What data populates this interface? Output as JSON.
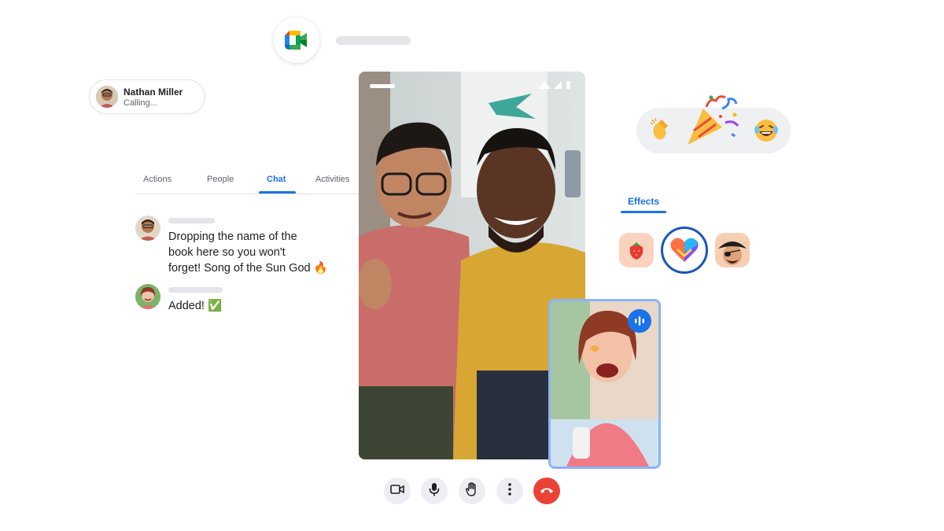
{
  "caller": {
    "name": "Nathan Miller",
    "status": "Calling..."
  },
  "tabs": [
    {
      "label": "Actions"
    },
    {
      "label": "People"
    },
    {
      "label": "Chat"
    },
    {
      "label": "Activities"
    }
  ],
  "active_tab": "Chat",
  "chat": {
    "messages": [
      {
        "text_lines": [
          "Dropping the name of the",
          "book here so you won't",
          "forget! Song of the Sun God 🔥"
        ]
      },
      {
        "text_lines": [
          "Added! ✅"
        ]
      }
    ]
  },
  "effects": {
    "label": "Effects"
  },
  "icons": {
    "meet": "google-meet-icon",
    "camera": "video-camera-icon",
    "mic": "microphone-icon",
    "hand": "raise-hand-icon",
    "more": "more-vert-icon",
    "end": "end-call-icon",
    "audio": "audio-wave-icon"
  },
  "colors": {
    "accent": "#1a73e8",
    "end_call": "#ea4335",
    "pip_border": "#8ab4f8"
  }
}
